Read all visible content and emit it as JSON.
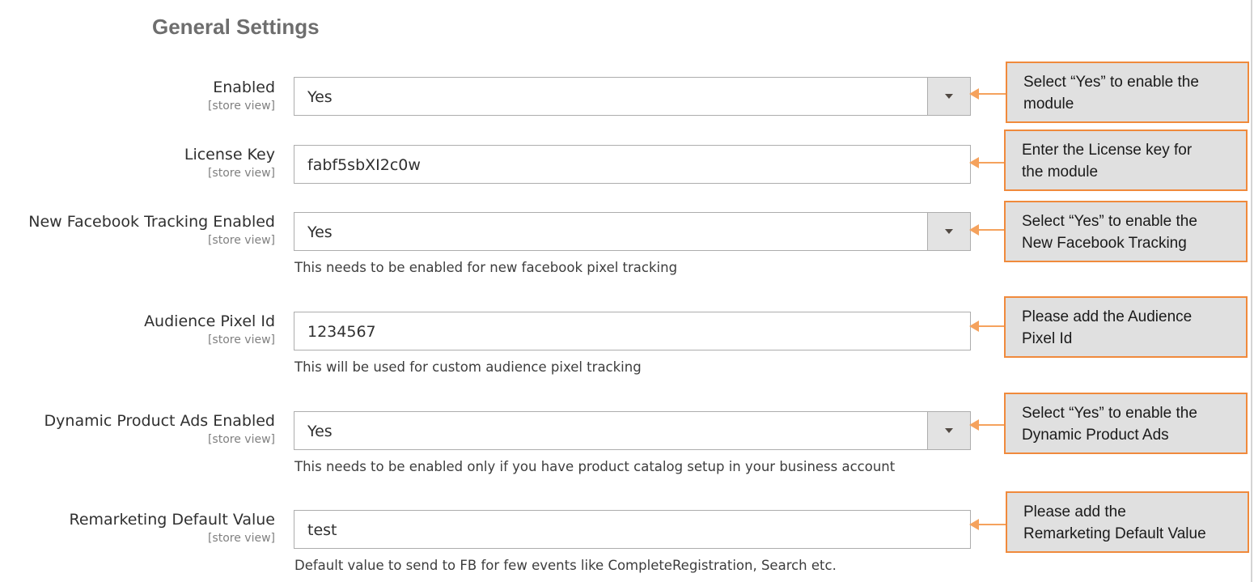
{
  "section_title": "General Settings",
  "fields": [
    {
      "label": "Enabled",
      "scope": "[store view]",
      "value": "Yes"
    },
    {
      "label": "License Key",
      "scope": "[store view]",
      "value": "fabf5sbXI2c0w"
    },
    {
      "label": "New Facebook Tracking Enabled",
      "scope": "[store view]",
      "value": "Yes",
      "note": "This needs to be enabled for new facebook pixel tracking"
    },
    {
      "label": "Audience Pixel Id",
      "scope": "[store view]",
      "value": "1234567",
      "note": "This will be used for custom audience pixel tracking"
    },
    {
      "label": "Dynamic Product Ads Enabled",
      "scope": "[store view]",
      "value": "Yes",
      "note": "This needs to be enabled only if you have product catalog setup in your business account"
    },
    {
      "label": "Remarketing Default Value",
      "scope": "[store view]",
      "value": "test",
      "note": "Default value to send to FB for few events like CompleteRegistration, Search etc."
    }
  ],
  "callouts": [
    {
      "line1": "Select “Yes” to enable the",
      "line2": "module"
    },
    {
      "line1": "Enter the License key for",
      "line2": "the module"
    },
    {
      "line1": "Select “Yes” to enable the",
      "line2": "New Facebook Tracking"
    },
    {
      "line1": "Please add the Audience",
      "line2": "Pixel Id"
    },
    {
      "line1": "Select “Yes” to enable the",
      "line2": "Dynamic Product Ads"
    },
    {
      "line1": "Please add the",
      "line2": "Remarketing Default Value"
    }
  ],
  "colors": {
    "callout_border": "#f08a3c",
    "callout_fill": "#e0e0e0",
    "arrow": "#f5a25d",
    "title": "#6e6e6e"
  },
  "icons": {
    "select_toggle": "chevron-down-icon",
    "callout_pointer": "arrow-left-icon"
  }
}
